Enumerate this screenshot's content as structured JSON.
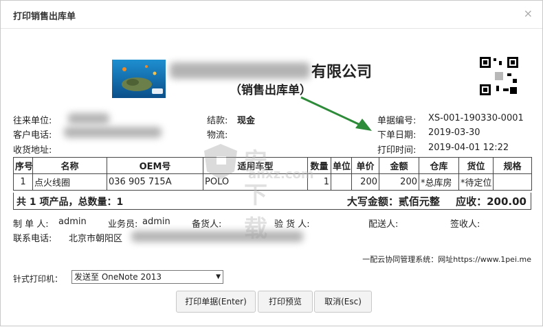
{
  "dialog": {
    "title": "打印销售出库单",
    "close_glyph": "×"
  },
  "header": {
    "company_suffix": "有限公司",
    "subtitle": "（销售出库单）"
  },
  "info": {
    "partner_label": "往来单位:",
    "phone_label": "客户电话:",
    "address_label": "收货地址:",
    "settlement_label": "结款:",
    "settlement_value": "现金",
    "logistics_label": "物流:",
    "doc_no_label": "单据编号:",
    "doc_no_value": "XS-001-190330-0001",
    "order_date_label": "下单日期:",
    "order_date_value": "2019-03-30",
    "print_time_label": "打印时间:",
    "print_time_value": "2019-04-01 12:22"
  },
  "table": {
    "headers": [
      "序号",
      "名称",
      "OEM号",
      "适用车型",
      "数量",
      "单位",
      "单价",
      "金额",
      "仓库",
      "货位",
      "规格"
    ],
    "rows": [
      [
        "1",
        "点火线圈",
        "036 905 715A",
        "POLO",
        "1",
        "",
        "200",
        "200",
        "*总库房",
        "*待定位",
        ""
      ]
    ]
  },
  "summary": {
    "left": "共 1 项产品，总数量：1",
    "amount_words": "大写金额：贰佰元整",
    "received": "应收：200.00"
  },
  "footer": {
    "maker_label": "制 单 人:",
    "maker_value": "admin",
    "sales_label": "业务员:",
    "sales_value": "admin",
    "stock_label": "备货人:",
    "check_label": "验 货 人:",
    "delivery_label": "配送人:",
    "sign_label": "签收人:",
    "contact_label": "联系电话:",
    "contact_value": "北京市朝阳区",
    "system_note": "一配云协同管理系统：网址https://www.1pei.me"
  },
  "printer": {
    "label": "针式打印机：",
    "selected": "发送至 OneNote 2013"
  },
  "buttons": {
    "print": "打印单据(Enter)",
    "preview": "打印预览",
    "cancel": "取消(Esc)"
  },
  "watermark": {
    "text1": "安下载",
    "text2": "anxz.com"
  },
  "colors": {
    "arrow": "#2e8b3a",
    "border": "#444444"
  }
}
